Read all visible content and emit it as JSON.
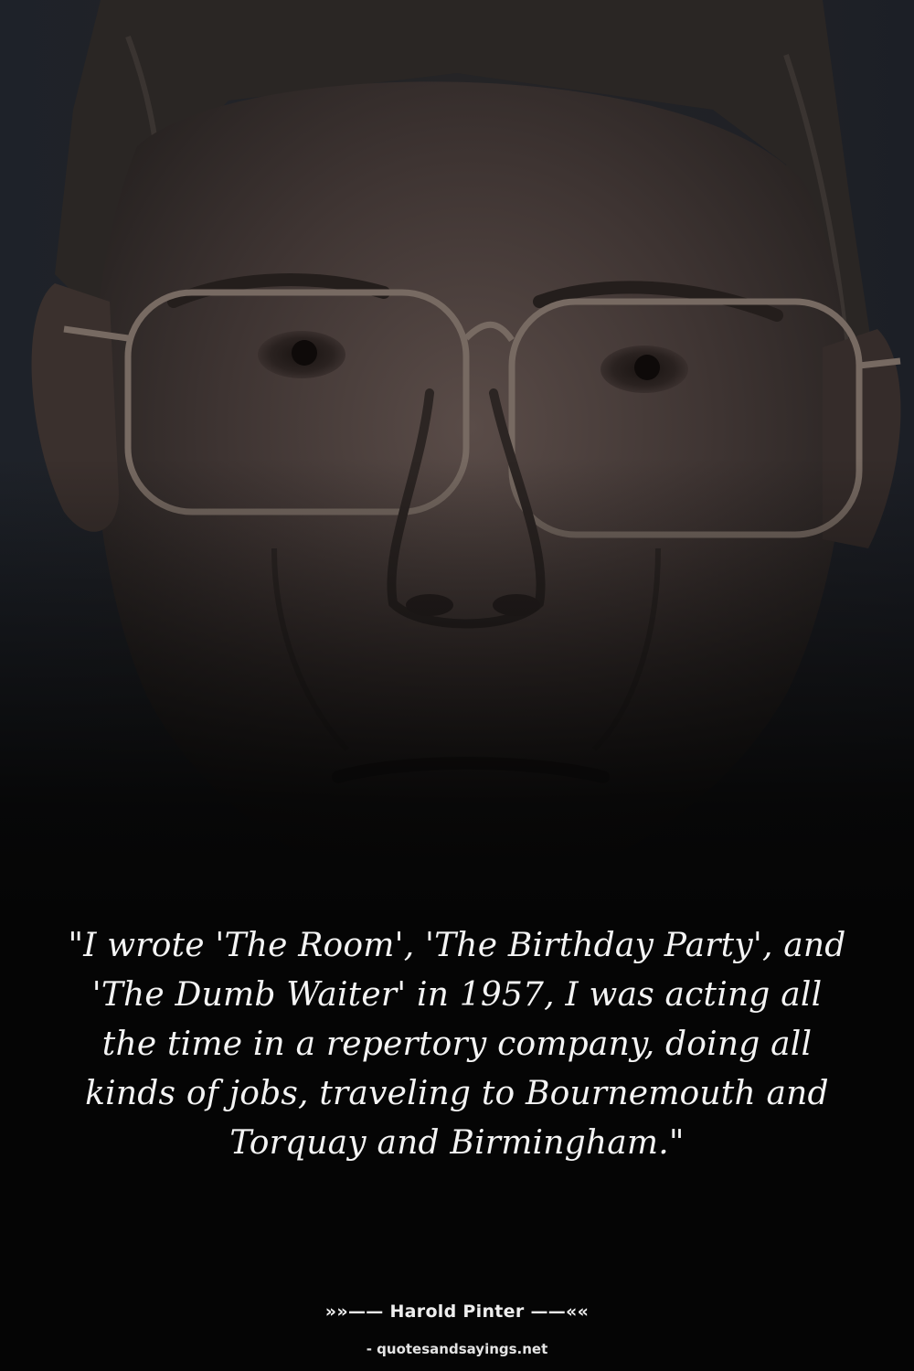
{
  "quote": {
    "text": "\"I wrote 'The Room', 'The Birthday Party', and 'The Dumb Waiter' in 1957, I was acting all the time in a repertory company, doing all kinds of jobs, traveling to Bournemouth and Torquay and Birmingham.\""
  },
  "attribution": {
    "text": "»»—— Harold Pinter ——««"
  },
  "source": {
    "text": "- quotesandsayings.net"
  },
  "colors": {
    "background": "#050505",
    "text": "#f4f4f4",
    "photo_tone": "#3a3230"
  }
}
